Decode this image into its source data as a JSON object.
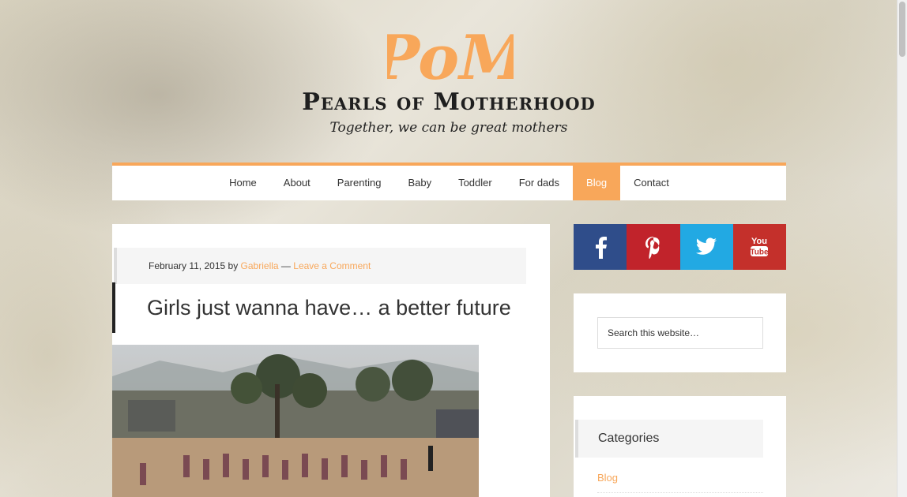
{
  "site": {
    "title": "Pearls of Motherhood",
    "tagline": "Together, we can be great mothers",
    "logo_text": "PoM",
    "accent": "#f8a75a"
  },
  "nav": {
    "items": [
      "Home",
      "About",
      "Parenting",
      "Baby",
      "Toddler",
      "For dads",
      "Blog",
      "Contact"
    ],
    "active": "Blog"
  },
  "post": {
    "date": "February 11, 2015",
    "by": "by",
    "author": "Gabriella",
    "separator": "—",
    "comment_link": "Leave a Comment",
    "title": "Girls just wanna have… a better future"
  },
  "social": [
    {
      "name": "facebook-icon",
      "color": "#2f4d8a"
    },
    {
      "name": "pinterest-icon",
      "color": "#c1232b"
    },
    {
      "name": "twitter-icon",
      "color": "#22a9e3"
    },
    {
      "name": "youtube-icon",
      "color": "#c4302b"
    }
  ],
  "search": {
    "placeholder": "Search this website…"
  },
  "categories": {
    "title": "Categories",
    "items": [
      "Blog"
    ]
  }
}
